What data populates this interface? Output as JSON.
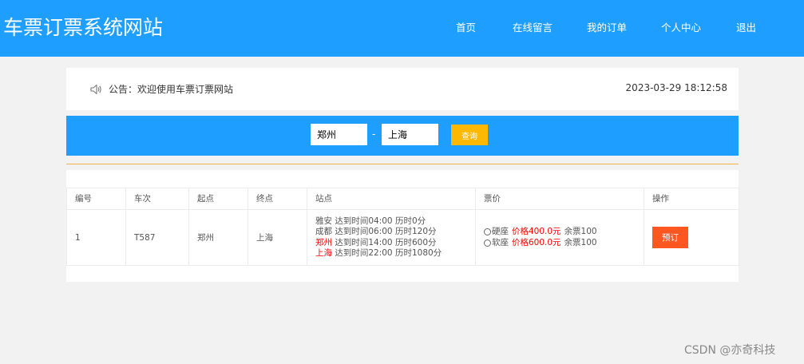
{
  "header": {
    "title": "车票订票系统网站",
    "nav": [
      "首页",
      "在线留言",
      "我的订单",
      "个人中心",
      "退出"
    ]
  },
  "notice": {
    "text": "公告：欢迎使用车票订票网站",
    "time": "2023-03-29 18:12:58"
  },
  "search": {
    "from": "郑州",
    "separator": "-",
    "to": "上海",
    "button": "查询"
  },
  "table": {
    "headers": [
      "编号",
      "车次",
      "起点",
      "终点",
      "站点",
      "票价",
      "操作"
    ],
    "rows": [
      {
        "id": "1",
        "train": "T587",
        "start": "郑州",
        "end": "上海",
        "stations": [
          {
            "name": "雅安",
            "arrive": "达到时间04:00",
            "elapsed": "历时0分",
            "highlight": false
          },
          {
            "name": "成都",
            "arrive": "达到时间06:00",
            "elapsed": "历时120分",
            "highlight": false
          },
          {
            "name": "郑州",
            "arrive": "达到时间14:00",
            "elapsed": "历时600分",
            "highlight": true
          },
          {
            "name": "上海",
            "arrive": "达到时间22:00",
            "elapsed": "历时1080分",
            "highlight": true
          }
        ],
        "prices": [
          {
            "seat": "硬座",
            "price": "价格400.0元",
            "remain": "余票100"
          },
          {
            "seat": "软座",
            "price": "价格600.0元",
            "remain": "余票100"
          }
        ],
        "action": "预订"
      }
    ]
  },
  "watermark": "CSDN @亦奇科技",
  "colors": {
    "primary": "#1e9fff",
    "query_button": "#ffb800",
    "book_button": "#ff5722",
    "highlight_text": "#ff0000"
  }
}
